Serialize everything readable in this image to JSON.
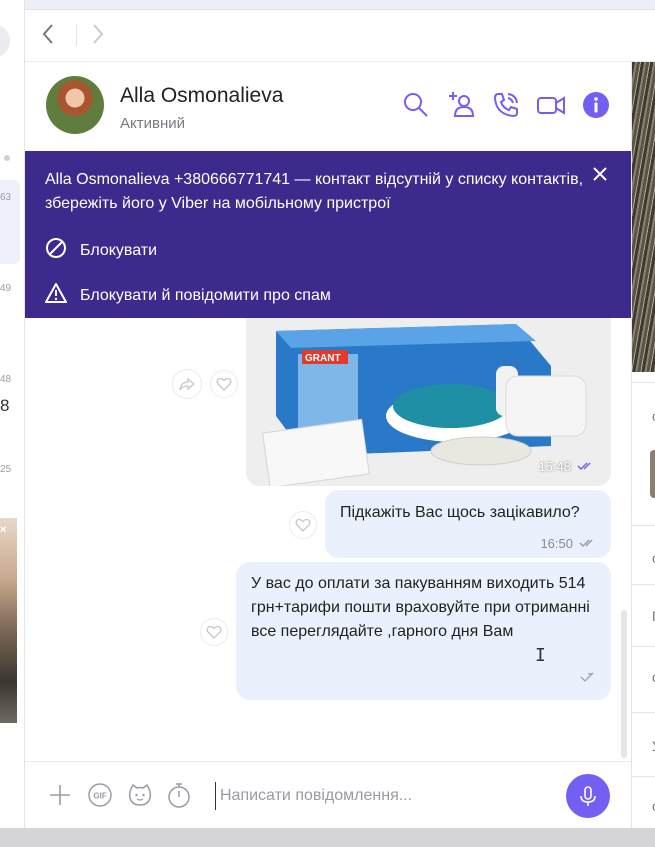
{
  "chat_list": {
    "times": [
      "63",
      "49",
      "48",
      "25"
    ],
    "unread_count": "8"
  },
  "nav": {
    "back_icon": "chevron-left-icon",
    "forward_icon": "chevron-right-icon"
  },
  "header": {
    "name": "Alla Osmonalieva",
    "status": "Активний",
    "icons": [
      "search-icon",
      "add-contact-icon",
      "voice-call-icon",
      "video-call-icon",
      "info-icon"
    ],
    "accent": "#7360f2"
  },
  "banner": {
    "text": "Alla Osmonalieva +380666771741 — контакт відсутній у списку контактів, збережіть його у Viber на мобільному пристрої",
    "block_label": "Блокувати",
    "report_label": "Блокувати й повідомити про спам",
    "background": "#3e2a8c"
  },
  "messages": [
    {
      "type": "image",
      "brand": "GRANT",
      "time": "15:48",
      "status": "read"
    },
    {
      "type": "text",
      "text": "Підкажіть Вас щось зацікавило?",
      "time": "16:50",
      "status": "delivered"
    },
    {
      "type": "text",
      "text": "У вас до оплати за пакуванням виходить 514 грн+тарифи пошти враховуйте при отриманні все переглядайте ,гарного дня Вам",
      "status": "sending"
    }
  ],
  "right_panel": {
    "letters": [
      "с",
      "с",
      "П",
      "с",
      "У",
      "с"
    ]
  },
  "composer": {
    "placeholder": "Написати повідомлення...",
    "icons": [
      "plus-icon",
      "gif-icon",
      "sticker-icon",
      "timer-icon",
      "microphone-icon"
    ]
  }
}
